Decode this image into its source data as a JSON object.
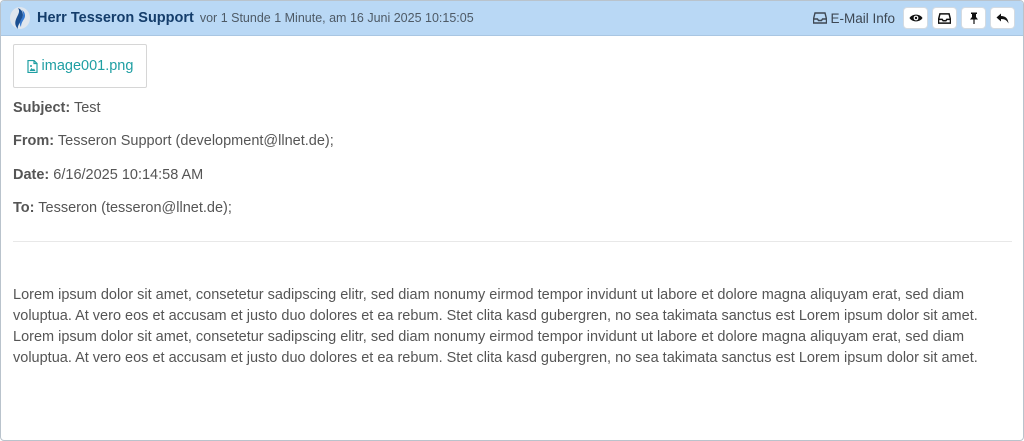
{
  "header": {
    "sender": "Herr Tesseron Support",
    "timestamp": "vor 1 Stunde 1 Minute, am 16 Juni 2025 10:15:05",
    "info_label": "E-Mail Info",
    "buttons": [
      "eye-icon",
      "inbox-icon",
      "pin-icon",
      "reply-icon"
    ],
    "background": "#b9d8f5"
  },
  "attachment": {
    "filename": "image001.png",
    "icon": "file-image-icon",
    "color": "#1f9fa3"
  },
  "meta": {
    "subject_label": "Subject:",
    "subject": "Test",
    "from_label": "From:",
    "from": "Tesseron Support (development@llnet.de);",
    "date_label": "Date:",
    "date": "6/16/2025 10:14:58 AM",
    "to_label": "To:",
    "to": "Tesseron (tesseron@llnet.de);"
  },
  "body": "Lorem ipsum dolor sit amet, consetetur sadipscing elitr, sed diam nonumy eirmod tempor invidunt ut labore et dolore magna aliquyam erat, sed diam voluptua. At vero eos et accusam et justo duo dolores et ea rebum. Stet clita kasd gubergren, no sea takimata sanctus est Lorem ipsum dolor sit amet. Lorem ipsum dolor sit amet, consetetur sadipscing elitr, sed diam nonumy eirmod tempor invidunt ut labore et dolore magna aliquyam erat, sed diam voluptua. At vero eos et accusam et justo duo dolores et ea rebum. Stet clita kasd gubergren, no sea takimata sanctus est Lorem ipsum dolor sit amet."
}
